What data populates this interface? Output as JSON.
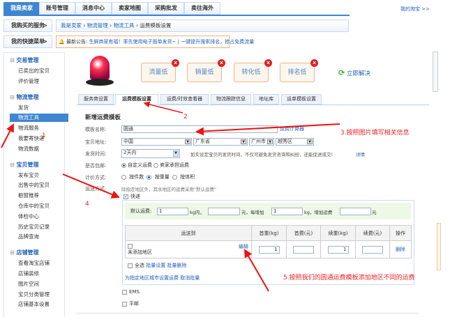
{
  "top_nav": {
    "tabs": [
      "我是卖家",
      "账号管理",
      "消息中心",
      "卖家地图",
      "采购批发",
      "卖往海外"
    ],
    "my_taobao": "我的淘宝 >>"
  },
  "row2": {
    "purchased_services": "我购买的服务",
    "quick_menu": "我的快捷菜单",
    "chevron": ">"
  },
  "breadcrumb": [
    "我是卖家",
    "物流管理",
    "物流工具",
    "运费模板设置"
  ],
  "announcement": {
    "label": "最新公告:",
    "text1": "生鲜商家有福！率先使用电子面单发货~",
    "sep": "|",
    "text2": "一键提升搜索排名，抢占免费流量"
  },
  "sidebar": {
    "groups": [
      {
        "title": "交易管理",
        "items": [
          "已卖出的宝贝",
          "评价管理"
        ]
      },
      {
        "title": "物流管理",
        "items": [
          "发货",
          "物流工具",
          "物流服务",
          "我要寄快递",
          "物流数据"
        ]
      },
      {
        "title": "宝贝管理",
        "items": [
          "发布宝贝",
          "出售中的宝贝",
          "橱窗推荐",
          "仓库中的宝贝",
          "体检中心",
          "历史宝贝记录",
          "品牌查询"
        ]
      },
      {
        "title": "店铺管理",
        "items": [
          "查看淘宝店铺",
          "店铺装修",
          "图片空间",
          "宝贝分类管理",
          "店铺基本设置"
        ]
      }
    ],
    "active": "物流工具"
  },
  "alerts": {
    "items": [
      "流量低",
      "销量低",
      "转化低",
      "排名低"
    ],
    "badge": "x",
    "solve": "立即解决"
  },
  "tabs": [
    "服务商设置",
    "运费模板设置",
    "运费/时效查看器",
    "物流跟踪信息",
    "地址库",
    "运单模板设置"
  ],
  "form": {
    "title": "新增运费模板",
    "name_label": "模板名称:",
    "name_value": "圆通",
    "calculator": "运费计算器",
    "address_label": "宝贝地址:",
    "country": "中国",
    "province": "广东省",
    "city": "广州市",
    "district": "越秀区",
    "ship_time_label": "发货时间:",
    "ship_time": "2天内",
    "ship_time_hint": "如实设定宝贝的发货时间，不仅可避免发货咨询和纠纷，还能促进成交!",
    "details": "详情",
    "free_label": "是否包邮:",
    "free_options": [
      "自定义运费",
      "卖家承担运费"
    ],
    "pricing_label": "计价方式:",
    "pricing_options": [
      "按件数",
      "按重量",
      "按体积"
    ],
    "method_label": "运送方式:",
    "method_hint": "除指定地区外，其余地区的运费采用\"默认运费\"",
    "express": "快递",
    "default_fee": {
      "label": "默认运费:",
      "first_weight": "1",
      "unit1": "kg内，",
      "first_fee": "",
      "unit2": "元，每增加",
      "add_weight": "1",
      "unit3": "kg，增加运费",
      "add_fee": "",
      "unit4": "元"
    },
    "table": {
      "headers": [
        "运送到",
        "首重(kg)",
        "首费(元)",
        "续重(kg)",
        "续费(元)",
        "操作"
      ],
      "row": {
        "region": "未添加地区",
        "edit": "编辑",
        "first_weight": "1",
        "first_fee": "",
        "add_weight": "1",
        "add_fee": "",
        "delete": "删除"
      }
    },
    "select_all": "全选",
    "batch_set": "批量设置",
    "batch_delete": "批量删除",
    "set_region": "为指定地区城市设置运费",
    "cancel_batch": "取消批量",
    "ems": "EMS",
    "post": "平邮"
  },
  "annotations": {
    "a1": "1",
    "a2": "2",
    "a3": "3.按照图片填写相关信息",
    "a4": "4",
    "a5": "5.按照我们的圆通运费模板添加地区不同的运费"
  }
}
